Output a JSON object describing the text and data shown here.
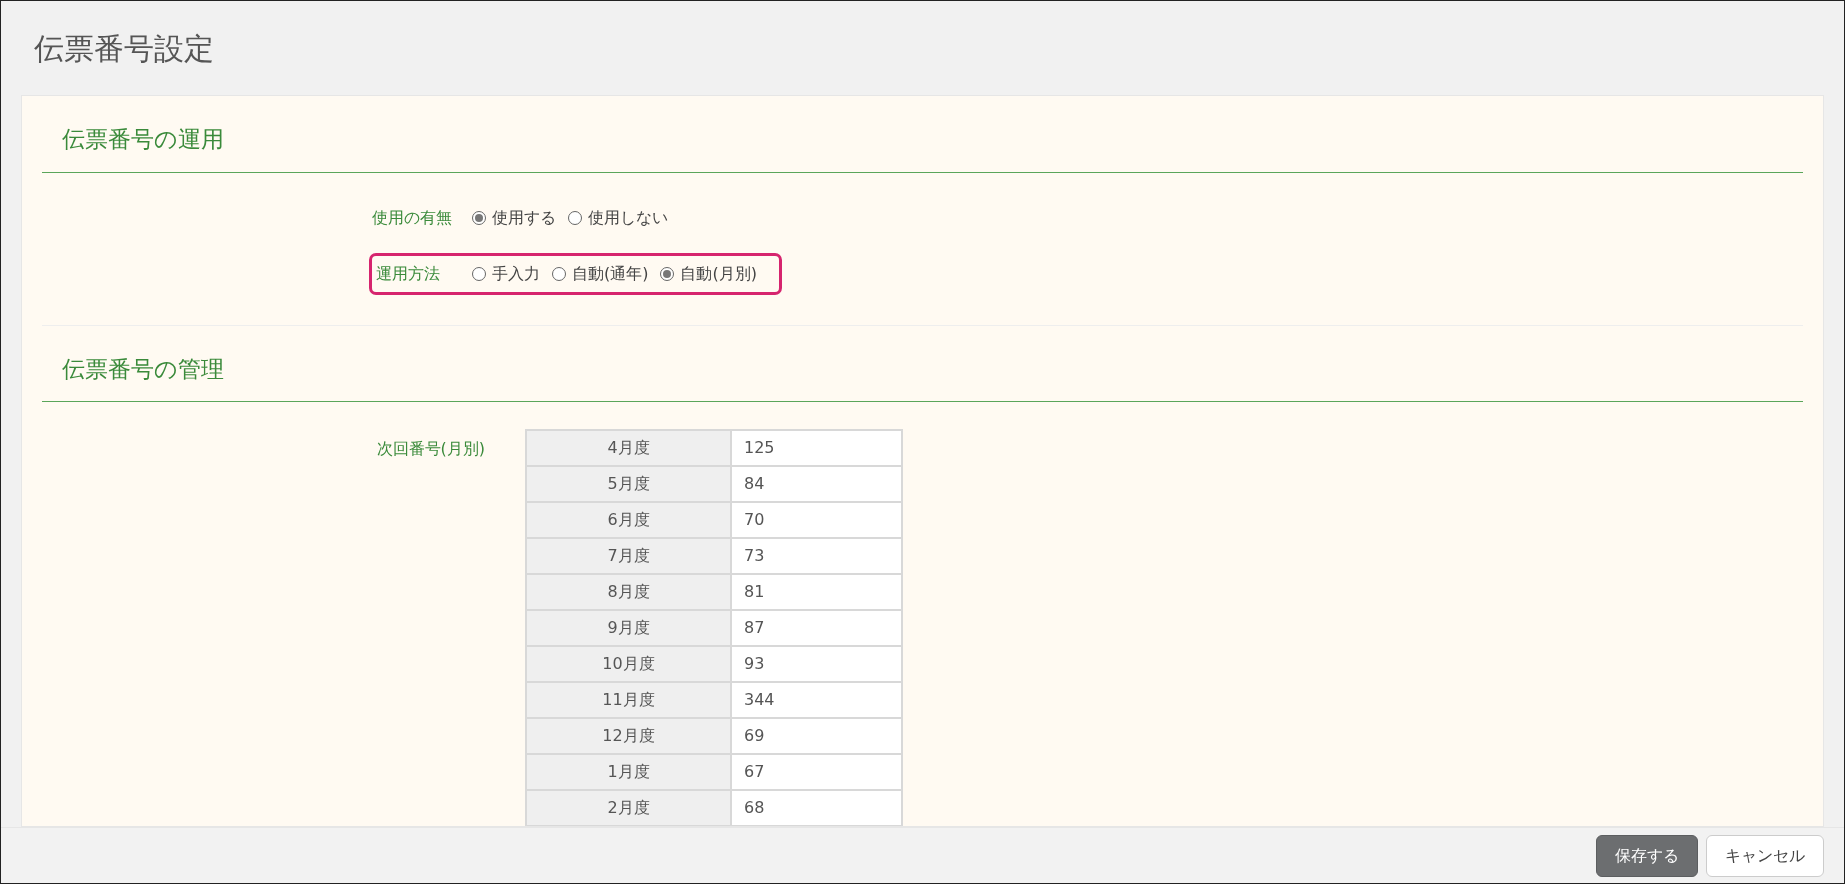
{
  "page": {
    "title": "伝票番号設定"
  },
  "sections": [
    {
      "title": "伝票番号の運用",
      "fields": [
        {
          "kind": "radio",
          "label": "使用の有無",
          "highlighted": false,
          "options": [
            {
              "label": "使用する",
              "selected": true
            },
            {
              "label": "使用しない",
              "selected": false
            }
          ]
        },
        {
          "kind": "radio",
          "label": "運用方法",
          "highlighted": true,
          "options": [
            {
              "label": "手入力",
              "selected": false
            },
            {
              "label": "自動(通年)",
              "selected": false
            },
            {
              "label": "自動(月別)",
              "selected": true
            }
          ]
        }
      ]
    },
    {
      "title": "伝票番号の管理",
      "fields": [
        {
          "kind": "table",
          "label": "次回番号(月別)",
          "highlighted": false,
          "rows": [
            {
              "month": "4月度",
              "value": "125"
            },
            {
              "month": "5月度",
              "value": "84"
            },
            {
              "month": "6月度",
              "value": "70"
            },
            {
              "month": "7月度",
              "value": "73"
            },
            {
              "month": "8月度",
              "value": "81"
            },
            {
              "month": "9月度",
              "value": "87"
            },
            {
              "month": "10月度",
              "value": "93"
            },
            {
              "month": "11月度",
              "value": "344"
            },
            {
              "month": "12月度",
              "value": "69"
            },
            {
              "month": "1月度",
              "value": "67"
            },
            {
              "month": "2月度",
              "value": "68"
            }
          ]
        }
      ]
    }
  ],
  "footer": {
    "buttons": [
      {
        "label": "保存する",
        "kind": "primary"
      },
      {
        "label": "キャンセル",
        "kind": "secondary"
      }
    ]
  }
}
